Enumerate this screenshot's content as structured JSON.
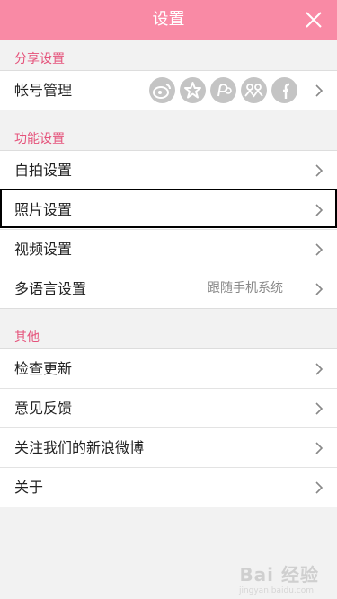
{
  "header": {
    "title": "设置"
  },
  "sections": {
    "share": {
      "label": "分享设置",
      "account": {
        "label": "帐号管理"
      },
      "icons": [
        "weibo-icon",
        "star-icon",
        "pinterest-icon",
        "people-icon",
        "facebook-icon"
      ]
    },
    "function": {
      "label": "功能设置",
      "items": [
        {
          "label": "自拍设置"
        },
        {
          "label": "照片设置"
        },
        {
          "label": "视频设置"
        },
        {
          "label": "多语言设置",
          "value": "跟随手机系统"
        }
      ]
    },
    "other": {
      "label": "其他",
      "items": [
        {
          "label": "检查更新"
        },
        {
          "label": "意见反馈"
        },
        {
          "label": "关注我们的新浪微博"
        },
        {
          "label": "关于"
        }
      ]
    }
  },
  "watermark": {
    "text": "Bai 经验",
    "sub": "jingyan.baidu.com"
  },
  "colors": {
    "header": "#f98aa5",
    "section_label": "#e5537b",
    "background": "#f2f2f2"
  }
}
